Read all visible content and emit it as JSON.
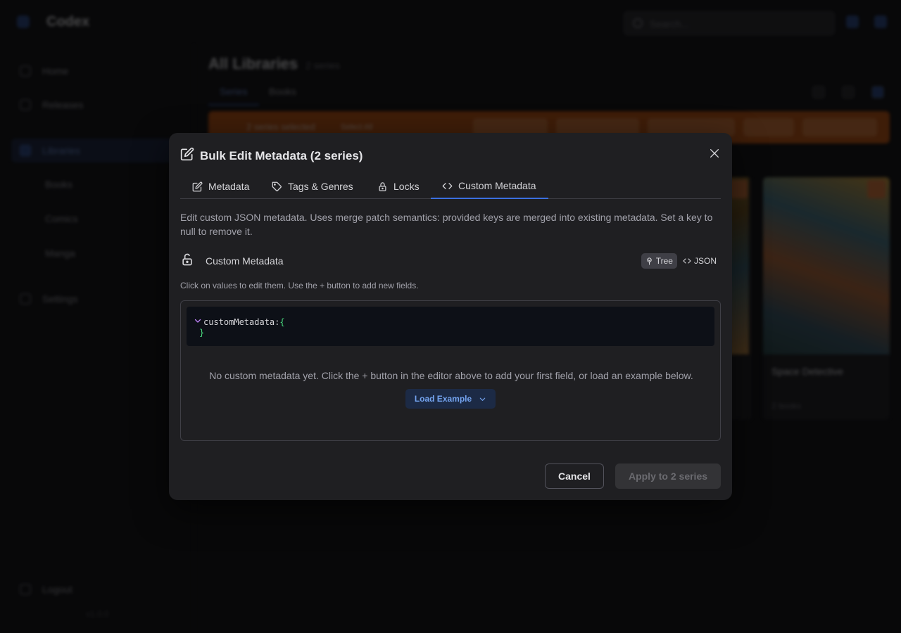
{
  "app": {
    "name": "Codex",
    "search_placeholder": "Search...",
    "nav": [
      {
        "label": "Home"
      },
      {
        "label": "Releases"
      },
      {
        "label": "Libraries"
      },
      {
        "label": "Books"
      },
      {
        "label": "Comics"
      },
      {
        "label": "Manga"
      },
      {
        "label": "Settings"
      },
      {
        "label": "Logout"
      }
    ],
    "version": "v1.0.0"
  },
  "main": {
    "title": "All Libraries",
    "count": "2 series",
    "tabs": [
      "Series",
      "Books"
    ],
    "selection_text": "2 series selected",
    "select_all": "Select All",
    "covers": [
      {
        "title": "",
        "sub": ""
      },
      {
        "title": "Space Detective",
        "sub": "2 books"
      }
    ]
  },
  "modal": {
    "title": "Bulk Edit Metadata (2 series)",
    "tabs": [
      {
        "label": "Metadata",
        "icon": "edit-icon"
      },
      {
        "label": "Tags & Genres",
        "icon": "tag-icon"
      },
      {
        "label": "Locks",
        "icon": "lock-icon"
      },
      {
        "label": "Custom Metadata",
        "icon": "code-icon",
        "active": true
      }
    ],
    "description": "Edit custom JSON metadata. Uses merge patch semantics: provided keys are merged into existing metadata. Set a key to null to remove it.",
    "section_label": "Custom Metadata",
    "view_modes": [
      {
        "label": "Tree",
        "icon": "tree-icon",
        "active": true
      },
      {
        "label": "JSON",
        "icon": "code-icon",
        "active": false
      }
    ],
    "hint": "Click on values to edit them. Use the + button to add new fields.",
    "editor": {
      "root_key": "customMetadata:",
      "open_brace": "{",
      "close_brace": "}"
    },
    "empty_message": "No custom metadata yet. Click the + button in the editor above to add your first field, or load an example below.",
    "load_example": "Load Example",
    "cancel": "Cancel",
    "apply": "Apply to 2 series"
  },
  "colors": {
    "accent": "#3b6fe0",
    "brace": "#4ade80",
    "tree_toggle": "#c084fc"
  }
}
